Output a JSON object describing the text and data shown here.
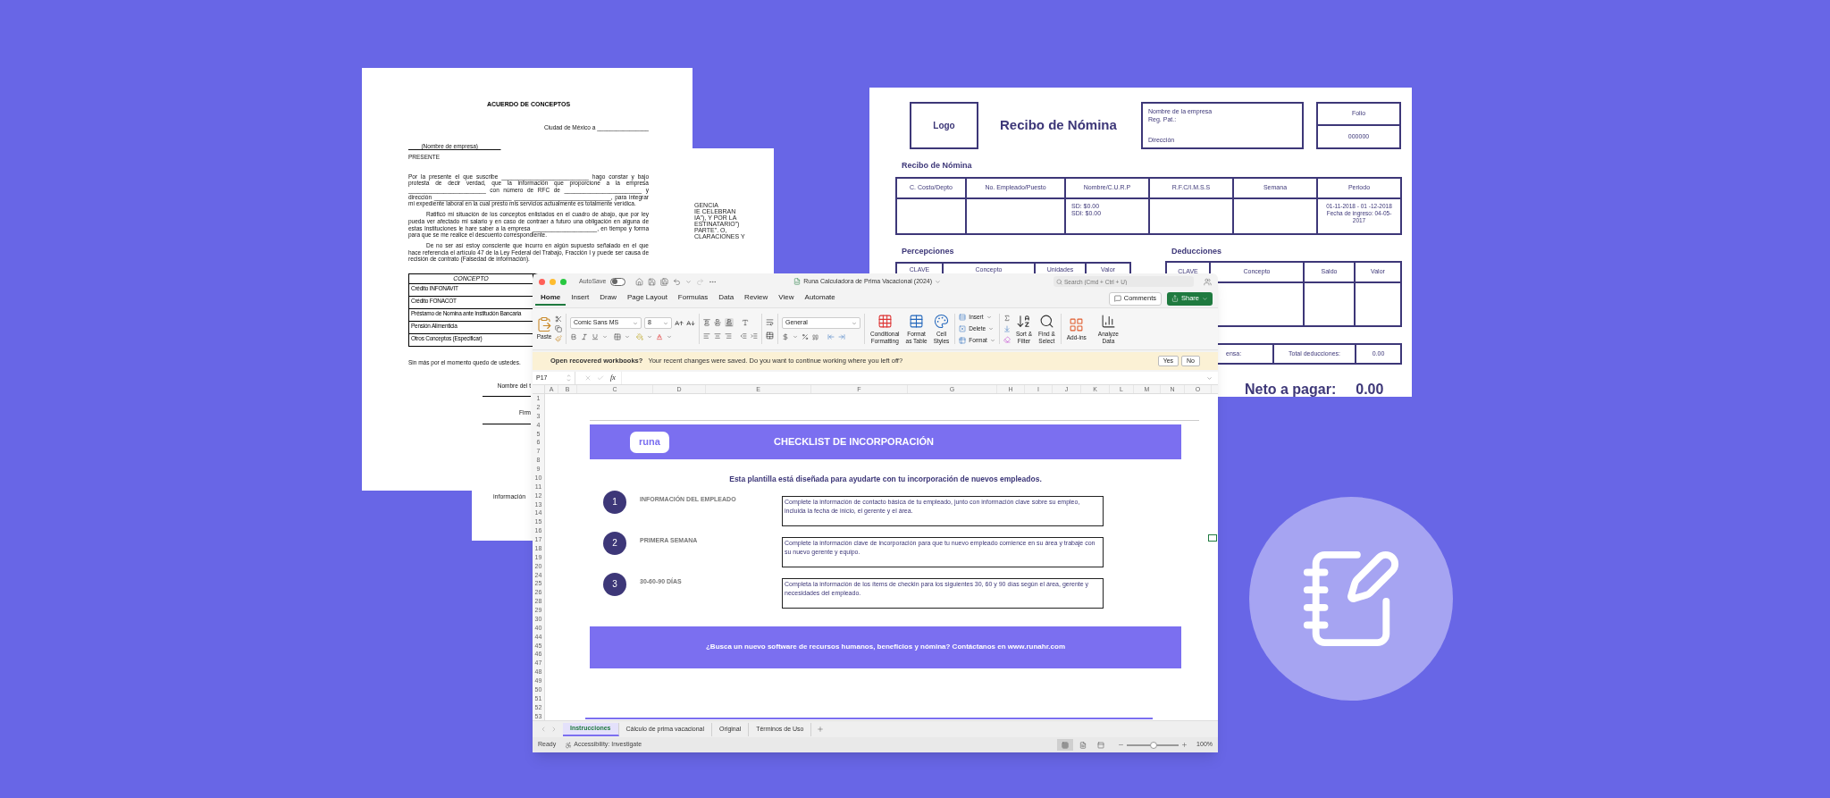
{
  "agreement_document": {
    "title": "ACUERDO DE CONCEPTOS",
    "city_line": "Ciudad de México a ________________",
    "company_line": "____(Nombre de empresa)_______",
    "greeting": "PRESENTE",
    "paragraphs": [
      "Por la presente el que suscribe ___________________________ hago constar y bajo protesta de decir verdad, que la información que proporcione a la empresa ________________________ con número de RFC de ________________________ y dirección ________________________ ______________________________, para integrar mi expediente laboral en la cual presto mis servicios actualmente es totalmente verídica.",
      "Ratificó mi situación de los conceptos enlistados en el cuadro de abajo, que por ley pueda ver afectado mi salario y en caso de contraer a futuro una obligación en alguna de estas Instituciones le hare saber a la empresa ____________________, en tiempo y forma para que se me realice el descuento correspondiente.",
      "De no ser así estoy consciente que incurro en algún supuesto señalado en el que hace referencia el artículo 47 de la Ley Federal del Trabajo, Fracción I y puede ser causa de recisión de contrato"
    ],
    "paragraph_note": "(Falsedad de información).",
    "table": {
      "header": "CONCEPTO",
      "rows": [
        "Crédito INFONAVIT",
        "Crédito FONACOT",
        "Préstamo de Nomina ante Institución Bancaria",
        "Pensión Alimenticia",
        "Otros Conceptos (Especificar)"
      ]
    },
    "closing": "Sin más por el momento quedo de ustedes.",
    "signature_name": "Nombre del t",
    "signature_sign": "Firm"
  },
  "contract_document": {
    "lines": [
      "GENCIA",
      "IE CELEBRAN",
      "IA\"), Y POR LA",
      "ESTINATARIO\")",
      "PARTE\". O,",
      "CLARACIONES Y"
    ],
    "footer": "información"
  },
  "payroll_receipt": {
    "logo": "Logo",
    "title": "Recibo de Nómina",
    "company_lines": [
      "Nombre de la empresa",
      "Reg. Pat.:"
    ],
    "address": "Dirección",
    "folio_label": "Folio",
    "folio_value": "000000",
    "section_title": "Recibo de Nómina",
    "columns": [
      "C. Costo/Depto",
      "No. Empleado/Puesto",
      "Nombre/C.U.R.P",
      "R.F.C/I.M.S.S",
      "Semana",
      "Periodo"
    ],
    "wage_lines": [
      "SD: $0.00",
      "SDI: $0.00"
    ],
    "period_lines": [
      "01-11-2018 - 01 -12-2018",
      "Fecha de ingreso: 04-05-2017"
    ],
    "perceptions": {
      "title": "Percepciones",
      "columns": [
        "CLAVE",
        "Concepto",
        "Unidades",
        "Valor"
      ]
    },
    "deductions": {
      "title": "Deducciones",
      "columns": [
        "CLAVE",
        "Concepto",
        "Saldo",
        "Valor"
      ]
    },
    "totals": [
      "ensa:",
      "Total deducciones:",
      "0.00"
    ],
    "net_label": "Neto a pagar:",
    "net_value": "0.00"
  },
  "spreadsheet": {
    "title_bar": {
      "autosave_label": "AutoSave",
      "autosave_on": false,
      "title": "Runa Calculadora de Prima Vacacional (2024)",
      "search_placeholder": "Search (Cmd + Ctrl + U)"
    },
    "tabs": [
      {
        "label": "Home",
        "selected": true
      },
      {
        "label": "Insert",
        "selected": false
      },
      {
        "label": "Draw",
        "selected": false
      },
      {
        "label": "Page Layout",
        "selected": false
      },
      {
        "label": "Formulas",
        "selected": false
      },
      {
        "label": "Data",
        "selected": false
      },
      {
        "label": "Review",
        "selected": false
      },
      {
        "label": "View",
        "selected": false
      },
      {
        "label": "Automate",
        "selected": false
      }
    ],
    "comments_button": "Comments",
    "share_button": "Share",
    "ribbon": {
      "paste": "Paste",
      "font": "Comic Sans MS",
      "font_size": "8",
      "number_format": "General",
      "style_buttons": [
        [
          "Conditional",
          "Formatting"
        ],
        [
          "Format",
          "as Table"
        ],
        [
          "Cell",
          "Styles"
        ]
      ],
      "cell_buttons": [
        "Insert",
        "Delete",
        "Format"
      ],
      "edit_buttons": [
        [
          "Sort &",
          "Filter"
        ],
        [
          "Find &",
          "Select"
        ]
      ],
      "extra_buttons": [
        [
          "Add-ins"
        ],
        [
          "Analyze",
          "Data"
        ]
      ]
    },
    "message_bar": {
      "title": "Open recovered workbooks?",
      "text": "Your recent changes were saved. Do you want to continue working where you left off?",
      "buttons": [
        "Yes",
        "No"
      ]
    },
    "formula_bar": {
      "cell": "P17",
      "fx": "fx"
    },
    "columns": [
      "A",
      "B",
      "C",
      "D",
      "E",
      "F",
      "G",
      "H",
      "I",
      "J",
      "K",
      "L",
      "M",
      "N",
      "O"
    ],
    "rows": [
      "1",
      "2",
      "3",
      "4",
      "5",
      "6",
      "7",
      "8",
      "9",
      "10",
      "11",
      "12",
      "13",
      "14",
      "15",
      "16",
      "17",
      "18",
      "19",
      "20",
      "24",
      "25",
      "26",
      "28",
      "29",
      "30",
      "40",
      "44",
      "45",
      "46",
      "47",
      "48",
      "49",
      "50",
      "51",
      "52",
      "53"
    ],
    "sheet": {
      "logo": "runa",
      "title": "CHECKLIST DE INCORPORACIÓN",
      "intro": "Esta plantilla está diseñada para ayudarte con tu incorporación de nuevos empleados.",
      "steps": [
        {
          "number": "1",
          "title": "INFORMACIÓN DEL EMPLEADO",
          "description": "Complete la información de contacto básica de tu empleado, junto con información clave sobre su empleo, incluida la fecha de inicio, el gerente y el área."
        },
        {
          "number": "2",
          "title": "PRIMERA SEMANA",
          "description": "Complete la información clave de incorporación para que tu nuevo empleado comience en su área y trabaje con su nuevo gerente y equipo."
        },
        {
          "number": "3",
          "title": "30-60-90 DÍAS",
          "description": "Completa la información de los ítems de checkin para los siguientes 30, 60 y 90 días según el área, gerente y necesidades del empleado."
        }
      ],
      "footer": "¿Busca un nuevo software de recursos humanos, beneficios y nómina? Contáctanos en www.runahr.com"
    },
    "sheet_tabs": [
      {
        "label": "Instrucciones",
        "selected": true
      },
      {
        "label": "Cálculo de prima vacacional",
        "selected": false
      },
      {
        "label": "Original",
        "selected": false
      },
      {
        "label": "Términos de Uso",
        "selected": false
      }
    ],
    "status_bar": {
      "status": "Ready",
      "accessibility": "Accessibility: Investigate",
      "view_modes": [
        {
          "selected": true
        },
        {
          "selected": false
        },
        {
          "selected": false
        }
      ],
      "zoom_slider": {
        "level": 0.52
      },
      "zoom": "100%"
    }
  }
}
